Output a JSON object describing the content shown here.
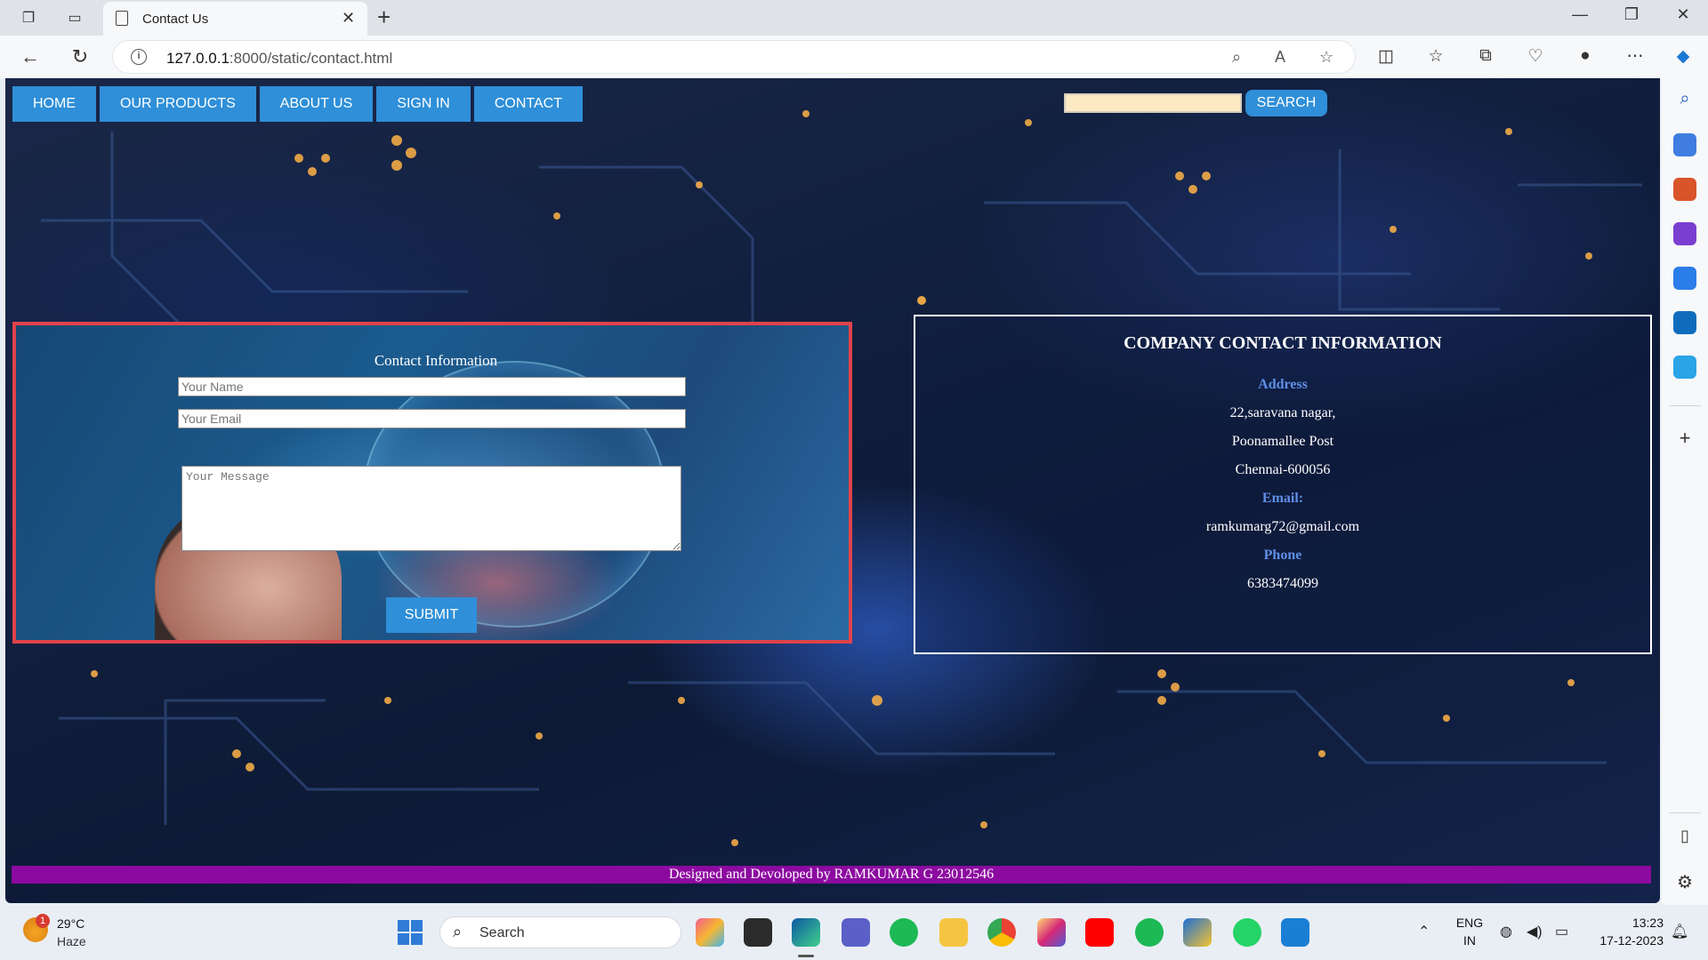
{
  "browser": {
    "tab_title": "Contact Us",
    "url_host": "127.0.0.1",
    "url_rest": ":8000/static/contact.html"
  },
  "page": {
    "nav": [
      "HOME",
      "OUR PRODUCTS",
      "ABOUT US",
      "SIGN IN",
      "CONTACT"
    ],
    "search_button": "SEARCH",
    "search_value": "",
    "form": {
      "title": "Contact Information",
      "name_placeholder": "Your Name",
      "email_placeholder": "Your Email",
      "message_placeholder": "Your Message",
      "submit": "SUBMIT"
    },
    "company": {
      "title": "COMPANY CONTACT INFORMATION",
      "address_label": "Address",
      "address_line1": "22,saravana nagar,",
      "address_line2": "Poonamallee Post",
      "address_line3": "Chennai-600056",
      "email_label": "Email:",
      "email": "ramkumarg72@gmail.com",
      "phone_label": "Phone",
      "phone": "6383474099"
    },
    "footer": "Designed and Devoloped by RAMKUMAR G 23012546"
  },
  "taskbar": {
    "weather_badge": "1",
    "temperature": "29°C",
    "condition": "Haze",
    "search_label": "Search",
    "language": "ENG",
    "region": "IN",
    "time": "13:23",
    "date": "17-12-2023"
  },
  "colors": {
    "nav_button": "#2f8fd8",
    "form_border": "#e0434a",
    "footer_bg": "#8c0aa0",
    "info_label": "#5f8fe6"
  }
}
